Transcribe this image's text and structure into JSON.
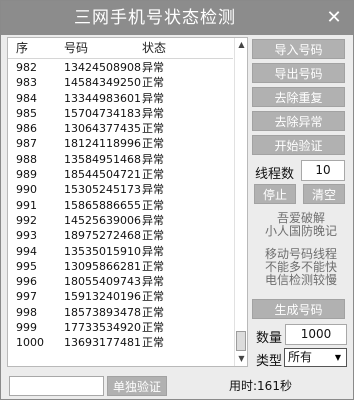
{
  "window": {
    "title": "三网手机号状态检测",
    "close_glyph": "✕"
  },
  "list": {
    "headers": {
      "seq": "序",
      "number": "号码",
      "status": "状态"
    },
    "rows": [
      {
        "seq": "982",
        "number": "13424508908",
        "status": "异常"
      },
      {
        "seq": "983",
        "number": "14584349250",
        "status": "正常"
      },
      {
        "seq": "984",
        "number": "13344983601",
        "status": "异常"
      },
      {
        "seq": "985",
        "number": "15704734183",
        "status": "异常"
      },
      {
        "seq": "986",
        "number": "13064377435",
        "status": "正常"
      },
      {
        "seq": "987",
        "number": "18124118996",
        "status": "正常"
      },
      {
        "seq": "988",
        "number": "13584951468",
        "status": "异常"
      },
      {
        "seq": "989",
        "number": "18544504721",
        "status": "正常"
      },
      {
        "seq": "990",
        "number": "15305245173",
        "status": "异常"
      },
      {
        "seq": "991",
        "number": "15865886655",
        "status": "正常"
      },
      {
        "seq": "992",
        "number": "14525639006",
        "status": "异常"
      },
      {
        "seq": "993",
        "number": "18975272468",
        "status": "正常"
      },
      {
        "seq": "994",
        "number": "13535015910",
        "status": "异常"
      },
      {
        "seq": "995",
        "number": "13095866281",
        "status": "正常"
      },
      {
        "seq": "996",
        "number": "18055409743",
        "status": "异常"
      },
      {
        "seq": "997",
        "number": "15913240196",
        "status": "正常"
      },
      {
        "seq": "998",
        "number": "18573893478",
        "status": "正常"
      },
      {
        "seq": "999",
        "number": "17733534920",
        "status": "正常"
      },
      {
        "seq": "1000",
        "number": "13693177481",
        "status": "正常"
      }
    ]
  },
  "sidebar": {
    "import_btn": "导入号码",
    "export_btn": "导出号码",
    "dedup_btn": "去除重复",
    "remove_abnormal_btn": "去除异常",
    "start_btn": "开始验证",
    "threads_label": "线程数",
    "threads_value": "10",
    "stop_btn": "停止",
    "clear_btn": "清空",
    "note1_line1": "吾爱破解",
    "note1_line2": "小人国防晚记",
    "note2_line1": "移动号码线程",
    "note2_line2": "不能多不能快",
    "note2_line3": "电信检测较慢",
    "generate_btn": "生成号码",
    "count_label": "数量",
    "count_value": "1000",
    "type_label": "类型",
    "type_value": "所有"
  },
  "footer": {
    "single_verify_btn": "单独验证",
    "time_text": "用时:161秒"
  },
  "colors": {
    "titlebar": "#8c8c8c",
    "button": "#b1b1b1",
    "panel": "#ececec"
  }
}
